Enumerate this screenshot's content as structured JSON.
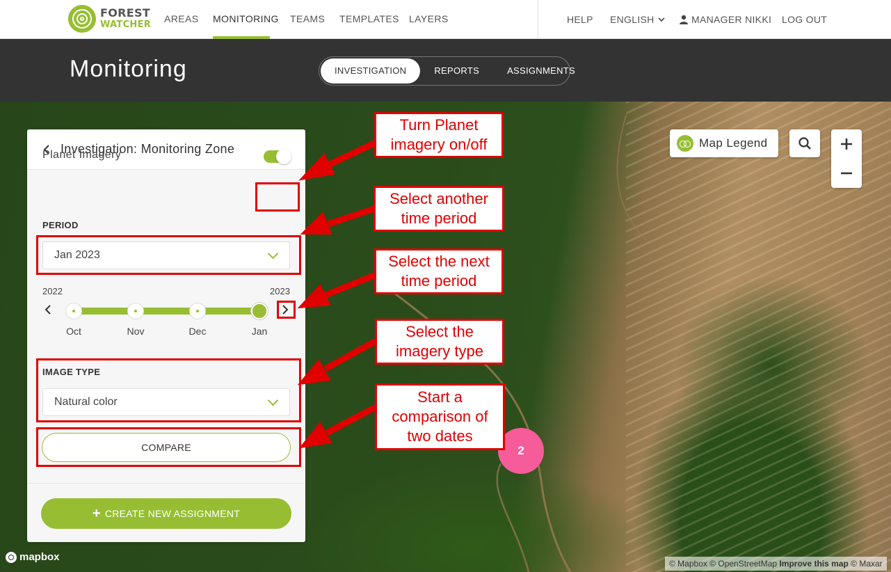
{
  "nav": {
    "logo_line1": "FOREST",
    "logo_line2": "WATCHER",
    "items": [
      "AREAS",
      "MONITORING",
      "TEAMS",
      "TEMPLATES",
      "LAYERS"
    ],
    "help": "HELP",
    "language": "ENGLISH",
    "user": "MANAGER NIKKI",
    "logout": "LOG OUT"
  },
  "header": {
    "title": "Monitoring",
    "tabs": [
      "INVESTIGATION",
      "REPORTS",
      "ASSIGNMENTS"
    ]
  },
  "panel": {
    "title": "Investigation: Monitoring Zone",
    "planet_label": "Planet Imagery",
    "planet_on": true,
    "period_label": "PERIOD",
    "period_value": "Jan 2023",
    "year_start": "2022",
    "year_end": "2023",
    "months": [
      "Oct",
      "Nov",
      "Dec",
      "Jan"
    ],
    "selected_month_index": 3,
    "image_type_label": "IMAGE TYPE",
    "image_type_value": "Natural color",
    "compare_label": "COMPARE",
    "create_label": "CREATE NEW ASSIGNMENT"
  },
  "map": {
    "legend_label": "Map Legend",
    "pin_label": "2",
    "mapbox_label": "mapbox",
    "attribution": {
      "part1": "© Mapbox © OpenStreetMap",
      "improve": "Improve this map",
      "part2": "© Maxar"
    }
  },
  "annotations": [
    "Turn Planet imagery on/off",
    "Select another time period",
    "Select the next time period",
    "Select the imagery type",
    "Start a comparison of two dates"
  ],
  "colors": {
    "brand_green": "#97be32",
    "header_dark": "#333333",
    "annotation_red": "#e00000",
    "pin_pink": "#f75c9a"
  }
}
